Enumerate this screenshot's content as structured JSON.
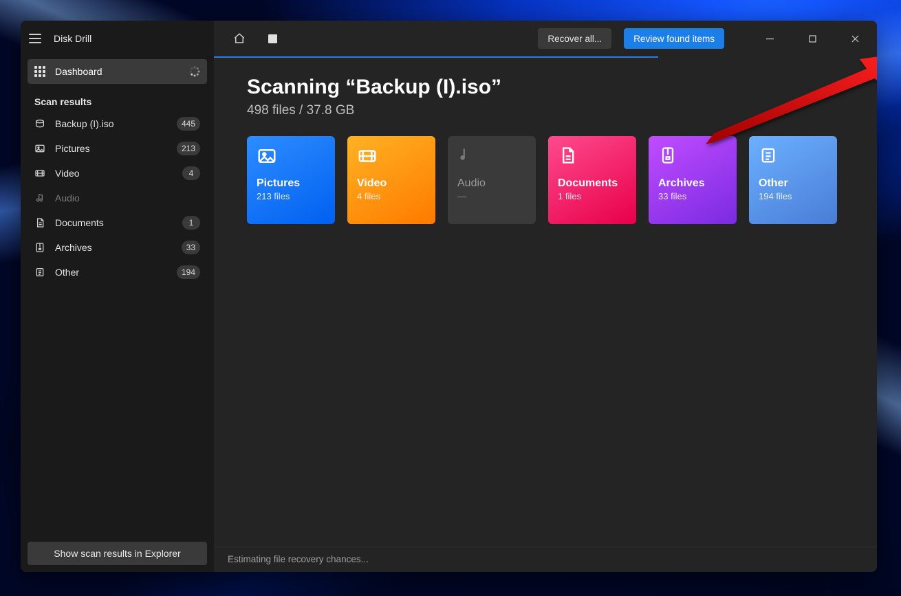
{
  "app": {
    "name": "Disk Drill"
  },
  "sidebar": {
    "dashboard_label": "Dashboard",
    "section_title": "Scan results",
    "footer_button": "Show scan results in Explorer",
    "items": [
      {
        "icon": "disk-icon",
        "label": "Backup (I).iso",
        "count": "445",
        "dim": false
      },
      {
        "icon": "picture-icon",
        "label": "Pictures",
        "count": "213",
        "dim": false
      },
      {
        "icon": "video-icon",
        "label": "Video",
        "count": "4",
        "dim": false
      },
      {
        "icon": "audio-icon",
        "label": "Audio",
        "count": "",
        "dim": true
      },
      {
        "icon": "document-icon",
        "label": "Documents",
        "count": "1",
        "dim": false
      },
      {
        "icon": "archive-icon",
        "label": "Archives",
        "count": "33",
        "dim": false
      },
      {
        "icon": "other-icon",
        "label": "Other",
        "count": "194",
        "dim": false
      }
    ]
  },
  "toolbar": {
    "recover_all": "Recover all...",
    "review_found": "Review found items"
  },
  "main": {
    "title": "Scanning “Backup (I).iso”",
    "subtitle": "498 files / 37.8 GB",
    "status": "Estimating file recovery chances...",
    "tiles": [
      {
        "key": "pictures",
        "name": "Pictures",
        "count": "213 files"
      },
      {
        "key": "video",
        "name": "Video",
        "count": "4 files"
      },
      {
        "key": "audio",
        "name": "Audio",
        "count": "—"
      },
      {
        "key": "documents",
        "name": "Documents",
        "count": "1 files"
      },
      {
        "key": "archives",
        "name": "Archives",
        "count": "33 files"
      },
      {
        "key": "other",
        "name": "Other",
        "count": "194 files"
      }
    ]
  }
}
